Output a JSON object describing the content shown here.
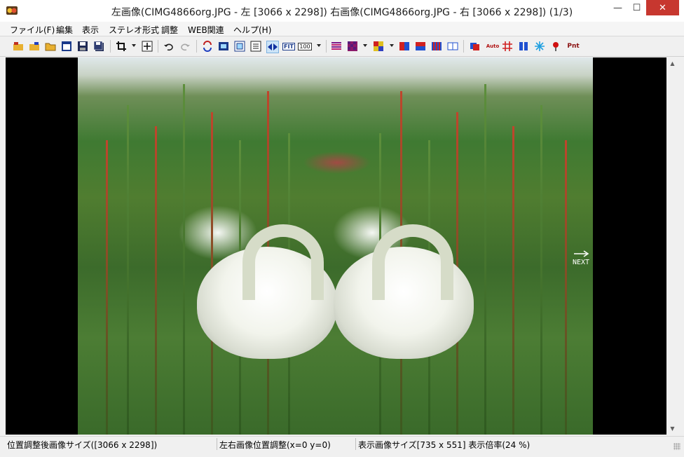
{
  "window": {
    "title": "左画像(CIMG4866org.JPG - 左 [3066 x 2298]) 右画像(CIMG4866org.JPG - 右 [3066 x 2298])  (1/3)",
    "minimize": "—",
    "maximize": "☐",
    "close": "✕"
  },
  "menu": {
    "file": "ファイル(F)",
    "edit": "編集",
    "view": "表示",
    "stereo": "ステレオ形式",
    "adjust": "調整",
    "web": "WEB関連",
    "help": "ヘルプ(H)"
  },
  "toolbar": {
    "fit_label": "FIT",
    "zoom100_label": "100",
    "auto_label": "Auto",
    "pnt_label": "Pnt"
  },
  "viewport": {
    "next_label": "NEXT"
  },
  "scrollbar": {
    "up": "▲",
    "down": "▼"
  },
  "status": {
    "image_size": "位置調整後画像サイズ([3066 x 2298])",
    "offset": "左右画像位置調整(x=0 y=0)",
    "display": "表示画像サイズ[735 x 551]  表示倍率(24 %)"
  },
  "colors": {
    "close_button": "#c7372f",
    "viewport_bg": "#000000",
    "toolbar_bg": "#f0f0f0"
  }
}
